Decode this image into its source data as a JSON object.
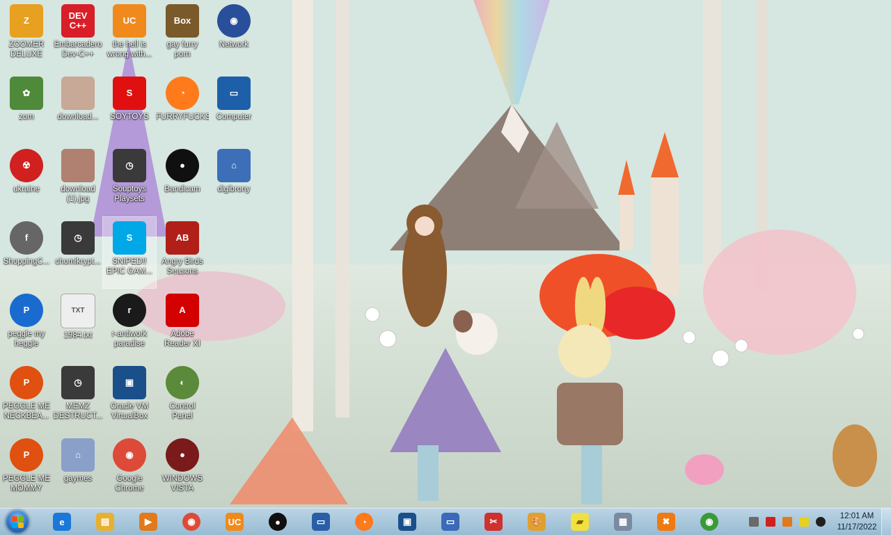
{
  "desktop": {
    "icons": [
      {
        "label": "ZOOMER\nDELUXE",
        "icon": "zoomer-app-icon",
        "color": "#e8a020",
        "glyph": "Z"
      },
      {
        "label": "Embarcadero\nDev-C++",
        "icon": "devcpp-icon",
        "color": "#d81e28",
        "glyph": "DEV\nC++"
      },
      {
        "label": "the hell is\nwrong with...",
        "icon": "uc-browser-icon",
        "color": "#f08a1c",
        "glyph": "UC"
      },
      {
        "label": "gay furry\nporn",
        "icon": "box-folder-icon",
        "color": "#7a5a2a",
        "glyph": "Box"
      },
      {
        "label": "Network",
        "icon": "network-icon",
        "color": "#2a4f9a",
        "glyph": "◉"
      },
      {
        "label": "zom",
        "icon": "flower-image-icon",
        "color": "#4f8a3a",
        "glyph": "✿"
      },
      {
        "label": "download...",
        "icon": "image-file-icon",
        "color": "#c8a896",
        "glyph": ""
      },
      {
        "label": "SOYTOYS",
        "icon": "soytoys-icon",
        "color": "#e01010",
        "glyph": "S"
      },
      {
        "label": "FURRYFUCKS",
        "icon": "firefox-icon",
        "color": "#ff7a1a",
        "glyph": "◔"
      },
      {
        "label": "Computer",
        "icon": "computer-icon",
        "color": "#1d5fa8",
        "glyph": "▭"
      },
      {
        "label": "ukraine",
        "icon": "radiation-icon",
        "color": "#d02020",
        "glyph": "☢"
      },
      {
        "label": "download\n(1).jpg",
        "icon": "image-file-icon",
        "color": "#b08070",
        "glyph": ""
      },
      {
        "label": "Souptoys\nPlaysets",
        "icon": "shortcut-clock-icon",
        "color": "#3a3a3a",
        "glyph": "◷"
      },
      {
        "label": "Bandicam",
        "icon": "bandicam-icon",
        "color": "#101010",
        "glyph": "●"
      },
      {
        "label": "digibrony",
        "icon": "setup-file-icon",
        "color": "#3d6fb8",
        "glyph": "⌂"
      },
      {
        "label": "ShoppingC...",
        "icon": "flash-icon",
        "color": "#666666",
        "glyph": "f"
      },
      {
        "label": "chomikrypt...",
        "icon": "shortcut-clock-icon",
        "color": "#3a3a3a",
        "glyph": "◷"
      },
      {
        "label": "SNIPED!!\nEPIC GAM...",
        "icon": "skype-icon",
        "color": "#00a8e8",
        "glyph": "S"
      },
      {
        "label": "Angry Birds\nSeasons",
        "icon": "angry-birds-icon",
        "color": "#b02018",
        "glyph": "AB"
      },
      {
        "label": "peggle my\nheggle",
        "icon": "peggle-icon",
        "color": "#1a6bd0",
        "glyph": "P"
      },
      {
        "label": "1984.txt",
        "icon": "text-file-icon",
        "color": "#eeeeee",
        "glyph": "TXT"
      },
      {
        "label": "r-antiwork\nparadise",
        "icon": "reddit-dark-icon",
        "color": "#1a1a1a",
        "glyph": "r"
      },
      {
        "label": "Adobe\nReader XI",
        "icon": "adobe-reader-icon",
        "color": "#d40000",
        "glyph": "A"
      },
      {
        "label": "PEGGLE ME\nNECKBEA...",
        "icon": "peggle-icon",
        "color": "#e05010",
        "glyph": "P"
      },
      {
        "label": "MEMZ\nDESTRUCT...",
        "icon": "shortcut-clock-icon",
        "color": "#3a3a3a",
        "glyph": "◷"
      },
      {
        "label": "Oracle VM\nVirtualBox",
        "icon": "virtualbox-icon",
        "color": "#1a4f8a",
        "glyph": "▣"
      },
      {
        "label": "Control\nPanel",
        "icon": "control-panel-icon",
        "color": "#5a8a3a",
        "glyph": "◐"
      },
      {
        "label": "PEGGLE ME\nMOMMY",
        "icon": "peggle-icon",
        "color": "#e05010",
        "glyph": "P"
      },
      {
        "label": "gaymes",
        "icon": "setup-file-icon",
        "color": "#8aa0c8",
        "glyph": "⌂"
      },
      {
        "label": "Google\nChrome",
        "icon": "chrome-icon",
        "color": "#dd4a38",
        "glyph": "◉"
      },
      {
        "label": "WINDOWS\nVISTA",
        "icon": "vista-bomb-icon",
        "color": "#7a1a1a",
        "glyph": "●"
      }
    ]
  },
  "taskbar": {
    "pinned": [
      {
        "name": "internet-explorer-icon",
        "color": "#1a78d8",
        "glyph": "e"
      },
      {
        "name": "file-explorer-icon",
        "color": "#e8b030",
        "glyph": "▤"
      },
      {
        "name": "media-player-icon",
        "color": "#e07a1a",
        "glyph": "▶"
      },
      {
        "name": "chrome-icon",
        "color": "#dd4a38",
        "glyph": "◉"
      },
      {
        "name": "uc-browser-icon",
        "color": "#f08a1c",
        "glyph": "UC"
      },
      {
        "name": "bandicam-icon",
        "color": "#101010",
        "glyph": "●"
      },
      {
        "name": "remote-desktop-icon",
        "color": "#2a5fa8",
        "glyph": "▭"
      },
      {
        "name": "firefox-icon",
        "color": "#ff7a1a",
        "glyph": "◔"
      },
      {
        "name": "virtualbox-icon",
        "color": "#1a4f8a",
        "glyph": "▣"
      },
      {
        "name": "network-map-icon",
        "color": "#3a6ab8",
        "glyph": "▭"
      },
      {
        "name": "snipping-tool-icon",
        "color": "#d03030",
        "glyph": "✂"
      },
      {
        "name": "paint-icon",
        "color": "#e0a030",
        "glyph": "🎨"
      },
      {
        "name": "sticky-notes-icon",
        "color": "#f0e040",
        "glyph": "▰"
      },
      {
        "name": "calculator-icon",
        "color": "#7a8aa0",
        "glyph": "▦"
      },
      {
        "name": "xampp-icon",
        "color": "#f07a10",
        "glyph": "✖"
      },
      {
        "name": "windows-update-icon",
        "color": "#3a9a3a",
        "glyph": "◉"
      }
    ],
    "tray": [
      {
        "name": "tray-app-icon",
        "color": "#6a6a6a"
      },
      {
        "name": "tray-v-icon",
        "color": "#d02020"
      },
      {
        "name": "tray-search-icon",
        "color": "#e07a1a"
      },
      {
        "name": "tray-notes-icon",
        "color": "#e8d020"
      },
      {
        "name": "tray-record-icon",
        "color": "#202020"
      }
    ],
    "clock": {
      "time": "12:01 AM",
      "date": "11/17/2022"
    }
  }
}
